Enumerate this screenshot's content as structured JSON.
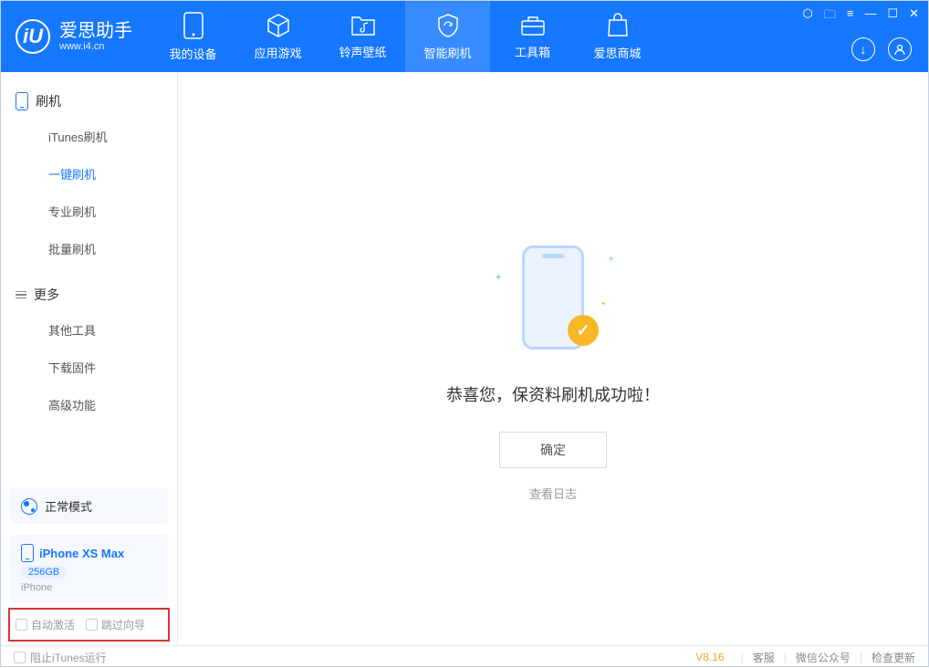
{
  "app": {
    "name": "爱思助手",
    "url": "www.i4.cn"
  },
  "tabs": [
    {
      "label": "我的设备"
    },
    {
      "label": "应用游戏"
    },
    {
      "label": "铃声壁纸"
    },
    {
      "label": "智能刷机"
    },
    {
      "label": "工具箱"
    },
    {
      "label": "爱思商城"
    }
  ],
  "sidebar": {
    "section1_title": "刷机",
    "section1_items": [
      "iTunes刷机",
      "一键刷机",
      "专业刷机",
      "批量刷机"
    ],
    "section2_title": "更多",
    "section2_items": [
      "其他工具",
      "下载固件",
      "高级功能"
    ]
  },
  "device_status": {
    "mode": "正常模式"
  },
  "device": {
    "name": "iPhone XS Max",
    "capacity": "256GB",
    "type": "iPhone"
  },
  "options": {
    "auto_activate": "自动激活",
    "skip_guide": "跳过向导"
  },
  "main": {
    "success_text": "恭喜您，保资料刷机成功啦！",
    "ok_button": "确定",
    "log_link": "查看日志"
  },
  "footer": {
    "block_itunes": "阻止iTunes运行",
    "version": "V8.16",
    "links": [
      "客服",
      "微信公众号",
      "检查更新"
    ]
  }
}
